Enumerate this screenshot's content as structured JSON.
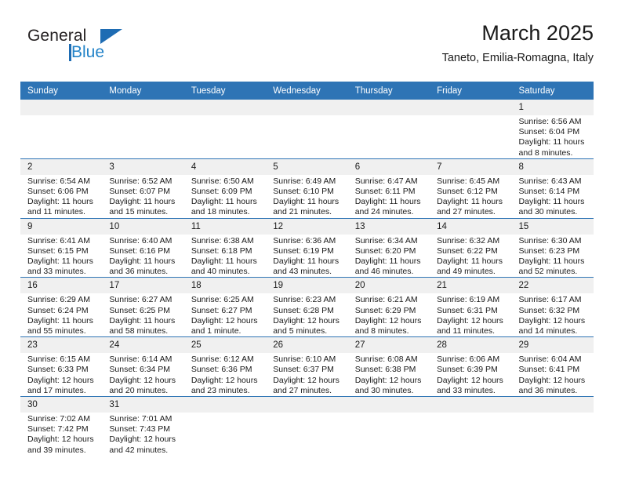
{
  "brand": {
    "name_part1": "General",
    "name_part2": "Blue",
    "logo_icon": "triangle-flag-icon"
  },
  "header": {
    "title": "March 2025",
    "subtitle": "Taneto, Emilia-Romagna, Italy"
  },
  "colors": {
    "header_blue": "#2e74b5",
    "daynum_band": "#f0f0f0",
    "brand_blue": "#2383c8",
    "text": "#1a1a1a"
  },
  "weekdays": [
    "Sunday",
    "Monday",
    "Tuesday",
    "Wednesday",
    "Thursday",
    "Friday",
    "Saturday"
  ],
  "labels": {
    "sunrise_prefix": "Sunrise:",
    "sunset_prefix": "Sunset:",
    "daylight_prefix": "Daylight:"
  },
  "weeks": [
    [
      {
        "day": "",
        "empty": true
      },
      {
        "day": "",
        "empty": true
      },
      {
        "day": "",
        "empty": true
      },
      {
        "day": "",
        "empty": true
      },
      {
        "day": "",
        "empty": true
      },
      {
        "day": "",
        "empty": true
      },
      {
        "day": "1",
        "sunrise": "Sunrise: 6:56 AM",
        "sunset": "Sunset: 6:04 PM",
        "daylight1": "Daylight: 11 hours",
        "daylight2": "and 8 minutes."
      }
    ],
    [
      {
        "day": "2",
        "sunrise": "Sunrise: 6:54 AM",
        "sunset": "Sunset: 6:06 PM",
        "daylight1": "Daylight: 11 hours",
        "daylight2": "and 11 minutes."
      },
      {
        "day": "3",
        "sunrise": "Sunrise: 6:52 AM",
        "sunset": "Sunset: 6:07 PM",
        "daylight1": "Daylight: 11 hours",
        "daylight2": "and 15 minutes."
      },
      {
        "day": "4",
        "sunrise": "Sunrise: 6:50 AM",
        "sunset": "Sunset: 6:09 PM",
        "daylight1": "Daylight: 11 hours",
        "daylight2": "and 18 minutes."
      },
      {
        "day": "5",
        "sunrise": "Sunrise: 6:49 AM",
        "sunset": "Sunset: 6:10 PM",
        "daylight1": "Daylight: 11 hours",
        "daylight2": "and 21 minutes."
      },
      {
        "day": "6",
        "sunrise": "Sunrise: 6:47 AM",
        "sunset": "Sunset: 6:11 PM",
        "daylight1": "Daylight: 11 hours",
        "daylight2": "and 24 minutes."
      },
      {
        "day": "7",
        "sunrise": "Sunrise: 6:45 AM",
        "sunset": "Sunset: 6:12 PM",
        "daylight1": "Daylight: 11 hours",
        "daylight2": "and 27 minutes."
      },
      {
        "day": "8",
        "sunrise": "Sunrise: 6:43 AM",
        "sunset": "Sunset: 6:14 PM",
        "daylight1": "Daylight: 11 hours",
        "daylight2": "and 30 minutes."
      }
    ],
    [
      {
        "day": "9",
        "sunrise": "Sunrise: 6:41 AM",
        "sunset": "Sunset: 6:15 PM",
        "daylight1": "Daylight: 11 hours",
        "daylight2": "and 33 minutes."
      },
      {
        "day": "10",
        "sunrise": "Sunrise: 6:40 AM",
        "sunset": "Sunset: 6:16 PM",
        "daylight1": "Daylight: 11 hours",
        "daylight2": "and 36 minutes."
      },
      {
        "day": "11",
        "sunrise": "Sunrise: 6:38 AM",
        "sunset": "Sunset: 6:18 PM",
        "daylight1": "Daylight: 11 hours",
        "daylight2": "and 40 minutes."
      },
      {
        "day": "12",
        "sunrise": "Sunrise: 6:36 AM",
        "sunset": "Sunset: 6:19 PM",
        "daylight1": "Daylight: 11 hours",
        "daylight2": "and 43 minutes."
      },
      {
        "day": "13",
        "sunrise": "Sunrise: 6:34 AM",
        "sunset": "Sunset: 6:20 PM",
        "daylight1": "Daylight: 11 hours",
        "daylight2": "and 46 minutes."
      },
      {
        "day": "14",
        "sunrise": "Sunrise: 6:32 AM",
        "sunset": "Sunset: 6:22 PM",
        "daylight1": "Daylight: 11 hours",
        "daylight2": "and 49 minutes."
      },
      {
        "day": "15",
        "sunrise": "Sunrise: 6:30 AM",
        "sunset": "Sunset: 6:23 PM",
        "daylight1": "Daylight: 11 hours",
        "daylight2": "and 52 minutes."
      }
    ],
    [
      {
        "day": "16",
        "sunrise": "Sunrise: 6:29 AM",
        "sunset": "Sunset: 6:24 PM",
        "daylight1": "Daylight: 11 hours",
        "daylight2": "and 55 minutes."
      },
      {
        "day": "17",
        "sunrise": "Sunrise: 6:27 AM",
        "sunset": "Sunset: 6:25 PM",
        "daylight1": "Daylight: 11 hours",
        "daylight2": "and 58 minutes."
      },
      {
        "day": "18",
        "sunrise": "Sunrise: 6:25 AM",
        "sunset": "Sunset: 6:27 PM",
        "daylight1": "Daylight: 12 hours",
        "daylight2": "and 1 minute."
      },
      {
        "day": "19",
        "sunrise": "Sunrise: 6:23 AM",
        "sunset": "Sunset: 6:28 PM",
        "daylight1": "Daylight: 12 hours",
        "daylight2": "and 5 minutes."
      },
      {
        "day": "20",
        "sunrise": "Sunrise: 6:21 AM",
        "sunset": "Sunset: 6:29 PM",
        "daylight1": "Daylight: 12 hours",
        "daylight2": "and 8 minutes."
      },
      {
        "day": "21",
        "sunrise": "Sunrise: 6:19 AM",
        "sunset": "Sunset: 6:31 PM",
        "daylight1": "Daylight: 12 hours",
        "daylight2": "and 11 minutes."
      },
      {
        "day": "22",
        "sunrise": "Sunrise: 6:17 AM",
        "sunset": "Sunset: 6:32 PM",
        "daylight1": "Daylight: 12 hours",
        "daylight2": "and 14 minutes."
      }
    ],
    [
      {
        "day": "23",
        "sunrise": "Sunrise: 6:15 AM",
        "sunset": "Sunset: 6:33 PM",
        "daylight1": "Daylight: 12 hours",
        "daylight2": "and 17 minutes."
      },
      {
        "day": "24",
        "sunrise": "Sunrise: 6:14 AM",
        "sunset": "Sunset: 6:34 PM",
        "daylight1": "Daylight: 12 hours",
        "daylight2": "and 20 minutes."
      },
      {
        "day": "25",
        "sunrise": "Sunrise: 6:12 AM",
        "sunset": "Sunset: 6:36 PM",
        "daylight1": "Daylight: 12 hours",
        "daylight2": "and 23 minutes."
      },
      {
        "day": "26",
        "sunrise": "Sunrise: 6:10 AM",
        "sunset": "Sunset: 6:37 PM",
        "daylight1": "Daylight: 12 hours",
        "daylight2": "and 27 minutes."
      },
      {
        "day": "27",
        "sunrise": "Sunrise: 6:08 AM",
        "sunset": "Sunset: 6:38 PM",
        "daylight1": "Daylight: 12 hours",
        "daylight2": "and 30 minutes."
      },
      {
        "day": "28",
        "sunrise": "Sunrise: 6:06 AM",
        "sunset": "Sunset: 6:39 PM",
        "daylight1": "Daylight: 12 hours",
        "daylight2": "and 33 minutes."
      },
      {
        "day": "29",
        "sunrise": "Sunrise: 6:04 AM",
        "sunset": "Sunset: 6:41 PM",
        "daylight1": "Daylight: 12 hours",
        "daylight2": "and 36 minutes."
      }
    ],
    [
      {
        "day": "30",
        "sunrise": "Sunrise: 7:02 AM",
        "sunset": "Sunset: 7:42 PM",
        "daylight1": "Daylight: 12 hours",
        "daylight2": "and 39 minutes."
      },
      {
        "day": "31",
        "sunrise": "Sunrise: 7:01 AM",
        "sunset": "Sunset: 7:43 PM",
        "daylight1": "Daylight: 12 hours",
        "daylight2": "and 42 minutes."
      },
      {
        "day": "",
        "empty": true
      },
      {
        "day": "",
        "empty": true
      },
      {
        "day": "",
        "empty": true
      },
      {
        "day": "",
        "empty": true
      },
      {
        "day": "",
        "empty": true
      }
    ]
  ]
}
